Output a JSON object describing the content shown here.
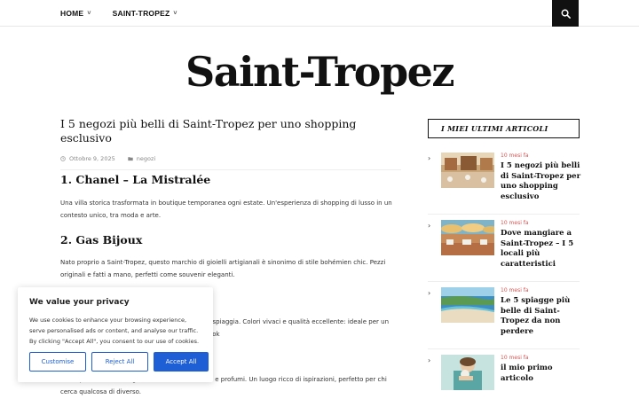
{
  "nav": {
    "items": [
      {
        "label": "HOME"
      },
      {
        "label": "SAINT-TROPEZ"
      }
    ],
    "chevron": "˅"
  },
  "site": {
    "title": "Saint-Tropez"
  },
  "post": {
    "title": "I 5 negozi più belli di Saint-Tropez per uno shopping esclusivo",
    "date": "Ottobre 9, 2025",
    "category": "negozi",
    "sections": [
      {
        "heading": "1. Chanel – La Mistralée",
        "text": "Una villa storica trasformata in boutique temporanea ogni estate. Un'esperienza di shopping di lusso in un contesto unico, tra moda e arte."
      },
      {
        "heading": "2. Gas Bijoux",
        "text": "Nato proprio a Saint-Tropez, questo marchio di gioielli artigianali è sinonimo di stile bohémien chic. Pezzi originali e fatti a mano, perfetti come souvenir eleganti."
      },
      {
        "text_partial": "a spiaggia. Colori vivaci e qualità eccellente: ideale per un look"
      },
      {
        "text": "Concept store con abbigliamento, accessori, arte e profumi. Un luogo ricco di ispirazioni, perfetto per chi cerca qualcosa di diverso."
      }
    ]
  },
  "sidebar": {
    "widget_title": "I MIEI ULTIMI ARTICOLI",
    "bullet": "›",
    "items": [
      {
        "date": "10 mesi fa",
        "title": "I 5 negozi più belli di Saint-Tropez per uno shopping esclusivo"
      },
      {
        "date": "10 mesi fa",
        "title": "Dove mangiare a Saint-Tropez – I 5 locali più caratteristici"
      },
      {
        "date": "10 mesi fa",
        "title": "Le 5 spiagge più belle di Saint-Tropez da non perdere"
      },
      {
        "date": "10 mesi fa",
        "title": "il mio primo articolo"
      }
    ]
  },
  "cookie": {
    "title": "We value your privacy",
    "text": "We use cookies to enhance your browsing experience, serve personalised ads or content, and analyse our traffic. By clicking \"Accept All\", you consent to our use of cookies.",
    "customise": "Customise",
    "reject": "Reject All",
    "accept": "Accept All"
  },
  "colors": {
    "accent_date": "#d9534f",
    "cookie_button": "#1e5fd6",
    "search_bg": "#111111"
  },
  "icons": {
    "search": "search-icon",
    "clock": "clock-icon",
    "folder": "folder-icon"
  }
}
